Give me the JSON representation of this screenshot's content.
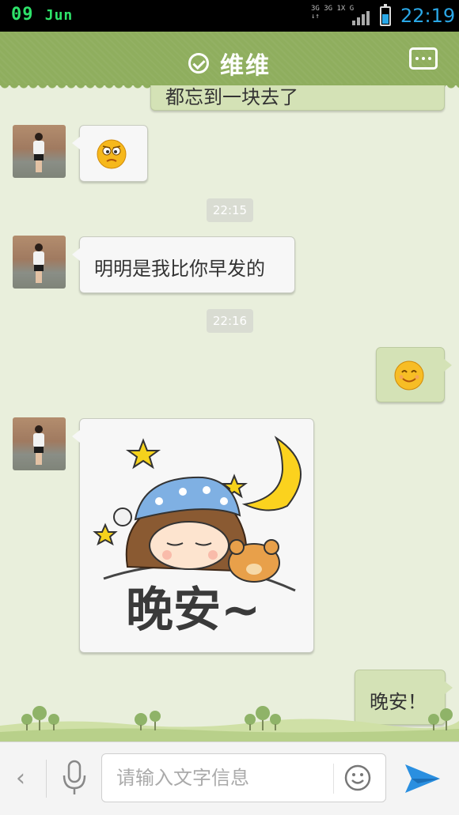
{
  "status_bar": {
    "date_day": "09",
    "date_month": "Jun",
    "network_top": "3G 3G 1X G",
    "network_bottom": "↓↑",
    "time": "22:19",
    "battery_level": 0.55
  },
  "header": {
    "title": "维维",
    "check_icon": "check-circle-icon",
    "menu_icon": "more-icon"
  },
  "messages": [
    {
      "side": "right",
      "type": "text",
      "text": "都忘到一块去了",
      "partial": true
    },
    {
      "side": "left",
      "type": "emoji",
      "emoji": "confused-face-icon"
    },
    {
      "type": "timestamp",
      "text": "22:15"
    },
    {
      "side": "left",
      "type": "text",
      "text": "明明是我比你早发的"
    },
    {
      "type": "timestamp",
      "text": "22:16"
    },
    {
      "side": "right",
      "type": "emoji",
      "emoji": "smiling-face-icon"
    },
    {
      "side": "left",
      "type": "sticker",
      "sticker": "good-night-girl-sticker",
      "caption": "晚安~"
    },
    {
      "side": "right",
      "type": "text",
      "text": "晚安！"
    }
  ],
  "input_bar": {
    "back_glyph": "‹",
    "placeholder": "请输入文字信息",
    "value": "",
    "icons": [
      "chevron-left-icon",
      "microphone-icon",
      "smiley-icon",
      "send-icon"
    ]
  },
  "colors": {
    "header_bg": "#8fae5e",
    "chat_bg": "#e9efdc",
    "outgoing_bubble": "#d4e2b6",
    "incoming_bubble": "#f7f7f7",
    "clock": "#2aa7e6",
    "date": "#2ee36a"
  }
}
